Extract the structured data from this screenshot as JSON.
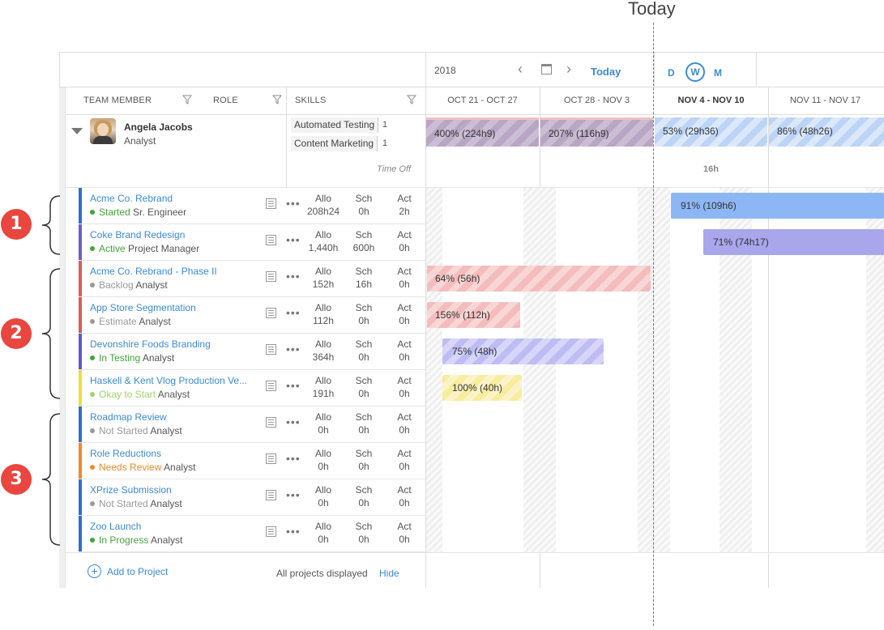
{
  "annotation": {
    "today_label": "Today"
  },
  "toolbar": {
    "year": "2018",
    "prev": "‹",
    "next": "›",
    "today": "Today",
    "zoom": [
      "D",
      "W",
      "M"
    ]
  },
  "columns": {
    "team_member": "TEAM MEMBER",
    "role": "ROLE",
    "skills": "SKILLS"
  },
  "weeks": [
    "OCT 21 - OCT 27",
    "OCT 28 - NOV 3",
    "NOV 4 - NOV 10",
    "NOV 11 - NOV 17"
  ],
  "member": {
    "name": "Angela Jacobs",
    "role": "Analyst",
    "skills": [
      {
        "name": "Automated Testing",
        "level": "1"
      },
      {
        "name": "Content Marketing",
        "level": "1"
      }
    ],
    "summary": [
      "400% (224h9)",
      "207% (116h9)",
      "53% (29h36)",
      "86% (48h26)"
    ],
    "time_off_label": "Time Off",
    "time_off_value": "16h"
  },
  "metric_labels": {
    "allo": "Allo",
    "sch": "Sch",
    "act": "Act"
  },
  "projects": [
    {
      "name": "Acme Co. Rebrand",
      "status": "Started",
      "role": "Sr. Engineer",
      "allo": "208h24",
      "sch": "0h",
      "act": "2h",
      "color": "#2f6fd0",
      "status_color": "#44a33a"
    },
    {
      "name": "Coke Brand Redesign",
      "status": "Active",
      "role": "Project Manager",
      "allo": "1,440h",
      "sch": "600h",
      "act": "0h",
      "color": "#6b5fc7",
      "status_color": "#44a33a"
    },
    {
      "name": "Acme Co. Rebrand - Phase II",
      "status": "Backlog",
      "role": "Analyst",
      "allo": "152h",
      "sch": "16h",
      "act": "0h",
      "color": "#e05a5a",
      "status_color": "#999999"
    },
    {
      "name": "App Store Segmentation",
      "status": "Estimate",
      "role": "Analyst",
      "allo": "112h",
      "sch": "0h",
      "act": "0h",
      "color": "#e05a5a",
      "status_color": "#999999"
    },
    {
      "name": "Devonshire Foods Branding",
      "status": "In Testing",
      "role": "Analyst",
      "allo": "364h",
      "sch": "0h",
      "act": "0h",
      "color": "#5a5ad0",
      "status_color": "#44a33a"
    },
    {
      "name": "Haskell & Kent Vlog Production Ve...",
      "status": "Okay to Start",
      "role": "Analyst",
      "allo": "191h",
      "sch": "0h",
      "act": "0h",
      "color": "#f2dc3c",
      "status_color": "#9fd36a"
    },
    {
      "name": "Roadmap Review",
      "status": "Not Started",
      "role": "Analyst",
      "allo": "0h",
      "sch": "0h",
      "act": "0h",
      "color": "#2f6fd0",
      "status_color": "#999999"
    },
    {
      "name": "Role Reductions",
      "status": "Needs Review",
      "role": "Analyst",
      "allo": "0h",
      "sch": "0h",
      "act": "0h",
      "color": "#ee8a2a",
      "status_color": "#ee8a2a"
    },
    {
      "name": "XPrize Submission",
      "status": "Not Started",
      "role": "Analyst",
      "allo": "0h",
      "sch": "0h",
      "act": "0h",
      "color": "#2f6fd0",
      "status_color": "#999999"
    },
    {
      "name": "Zoo Launch",
      "status": "In Progress",
      "role": "Analyst",
      "allo": "0h",
      "sch": "0h",
      "act": "0h",
      "color": "#2f6fd0",
      "status_color": "#44a33a"
    }
  ],
  "bars": [
    {
      "label": "91% (109h6)"
    },
    {
      "label": "71% (74h17)"
    },
    {
      "label": "64% (56h)"
    },
    {
      "label": "156% (112h)"
    },
    {
      "label": "75% (48h)"
    },
    {
      "label": "100% (40h)"
    }
  ],
  "footer": {
    "add_label": "Add to Project",
    "add_icon": "+",
    "displayed": "All projects displayed",
    "hide": "Hide"
  },
  "callouts": [
    "1",
    "2",
    "3"
  ]
}
